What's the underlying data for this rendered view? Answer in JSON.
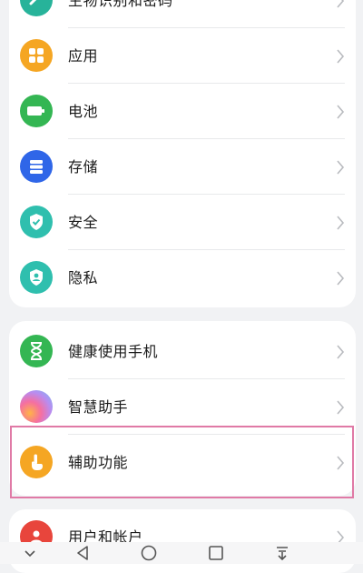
{
  "group1": {
    "items": [
      {
        "label": "生物识别和密码",
        "icon": "fingerprint-icon",
        "color": "#27b39a"
      },
      {
        "label": "应用",
        "icon": "apps-grid-icon",
        "color": "#f5a623"
      },
      {
        "label": "电池",
        "icon": "battery-icon",
        "color": "#34b653"
      },
      {
        "label": "存储",
        "icon": "storage-icon",
        "color": "#2f66e8"
      },
      {
        "label": "安全",
        "icon": "shield-check-icon",
        "color": "#2fbfae"
      },
      {
        "label": "隐私",
        "icon": "privacy-icon",
        "color": "#2fbfae"
      }
    ]
  },
  "group2": {
    "items": [
      {
        "label": "健康使用手机",
        "icon": "hourglass-icon",
        "color": "#34b653"
      },
      {
        "label": "智慧助手",
        "icon": "assistant-icon",
        "color": "#c27be6"
      },
      {
        "label": "辅助功能",
        "icon": "hand-pointer-icon",
        "color": "#f5a623"
      }
    ]
  },
  "group3": {
    "items": [
      {
        "label": "用户和帐户",
        "icon": "user-icon",
        "color": "#e8453c"
      }
    ]
  },
  "highlight_color": "#e07aa6",
  "navbar": {
    "buttons": [
      "collapse-icon",
      "back-icon",
      "home-icon",
      "recents-icon",
      "notification-pull-icon"
    ]
  }
}
